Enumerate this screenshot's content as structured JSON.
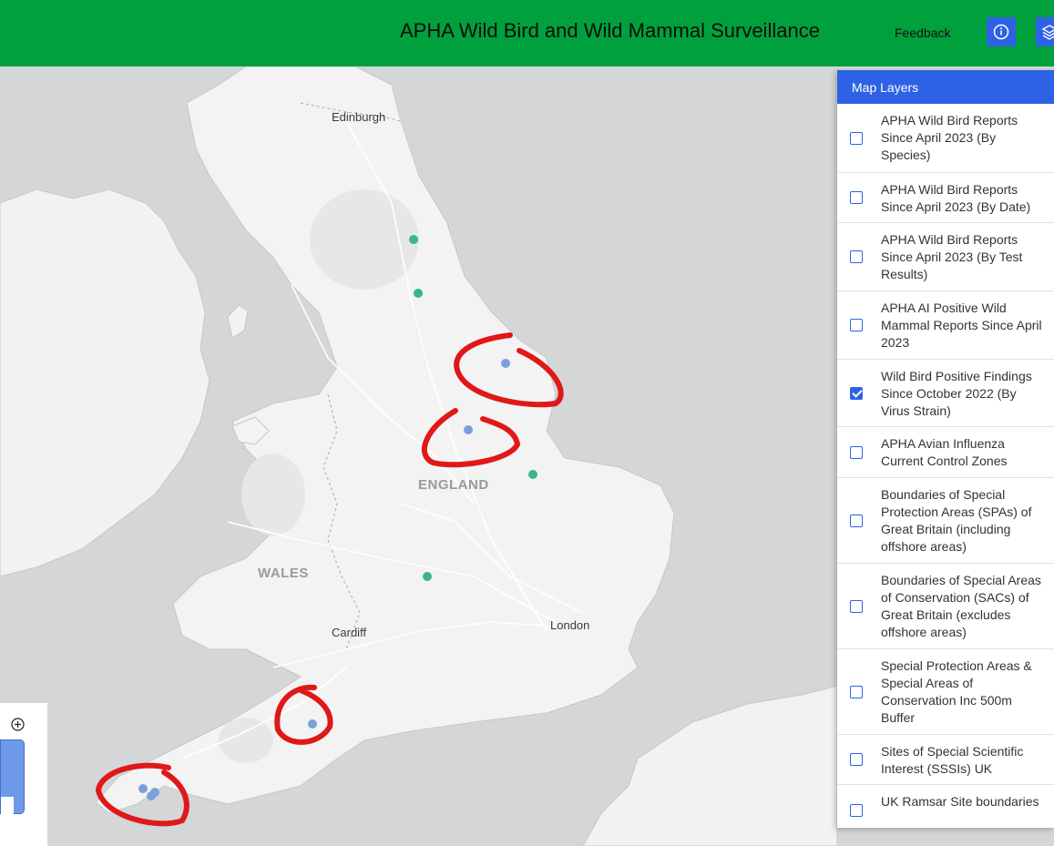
{
  "header": {
    "title": "APHA Wild Bird and Wild Mammal Surveillance",
    "feedback_label": "Feedback",
    "info_icon": "info-icon",
    "layers_icon": "layers-icon",
    "bar_color": "#00a13d",
    "button_color": "#2e62e6"
  },
  "map": {
    "labels": {
      "edinburgh": "Edinburgh",
      "england": "ENGLAND",
      "wales": "WALES",
      "cardiff": "Cardiff",
      "london": "London"
    },
    "marker_colors": {
      "green": "#3bb48f",
      "blue": "#7aa0dc",
      "annotation": "#e01818"
    }
  },
  "layers_panel": {
    "title": "Map Layers",
    "items": [
      {
        "label": "APHA Wild Bird Reports Since April 2023 (By Species)",
        "checked": false
      },
      {
        "label": "APHA Wild Bird Reports Since April 2023 (By Date)",
        "checked": false
      },
      {
        "label": "APHA Wild Bird Reports Since April 2023 (By Test Results)",
        "checked": false
      },
      {
        "label": "APHA AI Positive Wild Mammal Reports Since April 2023",
        "checked": false
      },
      {
        "label": "Wild Bird Positive Findings Since October 2022 (By Virus Strain)",
        "checked": true
      },
      {
        "label": "APHA Avian Influenza Current Control Zones",
        "checked": false
      },
      {
        "label": "Boundaries of Special Protection Areas (SPAs) of Great Britain (including offshore areas)",
        "checked": false
      },
      {
        "label": "Boundaries of Special Areas of Conservation (SACs) of Great Britain (excludes offshore areas)",
        "checked": false
      },
      {
        "label": "Special Protection Areas & Special Areas of Conservation Inc 500m Buffer",
        "checked": false
      },
      {
        "label": "Sites of Special Scientific Interest (SSSIs) UK",
        "checked": false
      },
      {
        "label": "UK Ramsar Site boundaries",
        "checked": false
      }
    ]
  },
  "zoom": {
    "icon": "zoom-in-icon"
  }
}
